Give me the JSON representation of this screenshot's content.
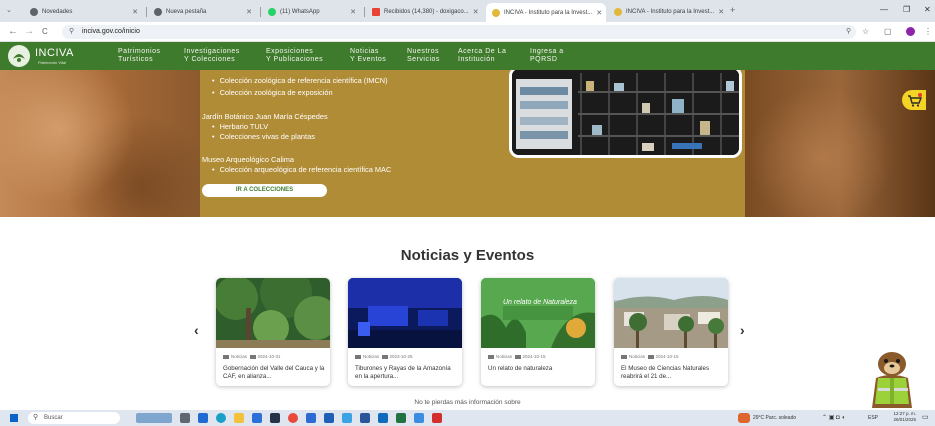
{
  "browser": {
    "tabs": [
      {
        "title": "Novedades"
      },
      {
        "title": "Nueva pestaña"
      },
      {
        "title": "(11) WhatsApp"
      },
      {
        "title": "Recibidos (14,380) - doxigaco..."
      },
      {
        "title": "INCIVA - Instituto para la Invest..."
      },
      {
        "title": "INCIVA - Instituto para la Invest..."
      }
    ],
    "new_tab": "+",
    "url": "inciva.gov.co/inicio",
    "window_controls": {
      "minimize": "—",
      "restore": "❐",
      "close": "✕"
    },
    "nav": {
      "back": "←",
      "forward": "→",
      "reload": "C"
    }
  },
  "site": {
    "logo_name": "INCIVA",
    "logo_tagline": "Patrimonio Vital",
    "menu": [
      {
        "line1": "Patrimonios",
        "line2": "Turísticos"
      },
      {
        "line1": "Investigaciones",
        "line2": "Y Colecciones"
      },
      {
        "line1": "Exposiciones",
        "line2": "Y Publicaciones"
      },
      {
        "line1": "Noticias",
        "line2": "Y Eventos"
      },
      {
        "line1": "Nuestros",
        "line2": "Servicios"
      },
      {
        "line1": "Acerca De La",
        "line2": "Institución"
      },
      {
        "line1": "Ingresa a",
        "line2": "PQRSD"
      }
    ],
    "brand_green": "#3f7b2d",
    "hero_gold": "#b08c36"
  },
  "hero": {
    "items": [
      "Colección zoológica de referencia científica (IMCN)",
      "Colección zoológica de exposición",
      "Jardín Botánico Juan María Céspedes",
      "Herbario TULV",
      "Colecciones vivas de plantas",
      "Museo Arqueológico Calima",
      "Colección arqueológica de referencia científica MAC"
    ],
    "button": "IR A COLECCIONES"
  },
  "news": {
    "title": "Noticias y Eventos",
    "cards": [
      {
        "category": "Noticias",
        "date": "2024-10-31",
        "title": "Gobernación del Valle del Cauca y la CAF, en alianza..."
      },
      {
        "category": "Noticias",
        "date": "2023-10-25",
        "title": "Tiburones y Rayas de la Amazonía en la apertura..."
      },
      {
        "category": "Noticias",
        "date": "2024-10-15",
        "title": "Un relato de naturaleza",
        "image_text": "Un relato de Naturaleza"
      },
      {
        "category": "Noticias",
        "date": "2024-10-15",
        "title": "El Museo de Ciencias Naturales reabrirá el 21 de..."
      }
    ],
    "prev": "‹",
    "next": "›",
    "more_info": "No te pierdas más información sobre"
  },
  "taskbar": {
    "search": "Buscar",
    "weather": "29°C  Parc. soleado",
    "lang": "ESP",
    "time": "12:27 p. m.",
    "date": "26/01/2025"
  }
}
